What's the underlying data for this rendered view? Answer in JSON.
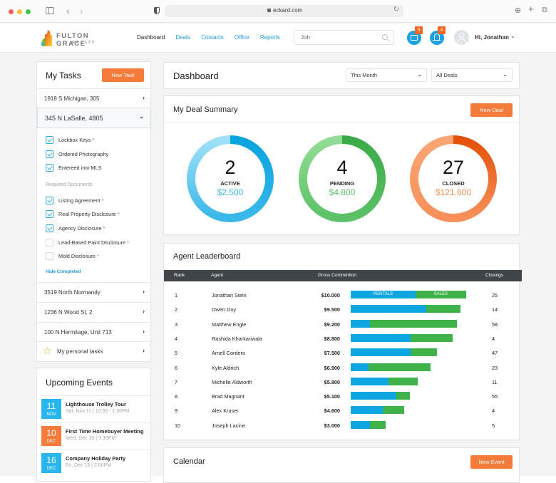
{
  "browser": {
    "url": "eckard.com"
  },
  "header": {
    "logo": {
      "brand": "FULTON GRACE",
      "sub": "REALTY"
    },
    "nav": [
      "Dashboard",
      "Deals",
      "Contacts",
      "Office",
      "Reports"
    ],
    "active_nav": "Dashboard",
    "search": {
      "value": "Joh"
    },
    "messages_badge": "5",
    "notifications_badge": "4",
    "greeting": "Hi, Jonathan"
  },
  "tasks": {
    "title": "My Tasks",
    "new_button": "New Task",
    "collapsed_top": {
      "label": "1918 S Michigan, 305"
    },
    "open_item": {
      "label": "345 N LaSalle, 4805",
      "checklist": [
        {
          "label": "Lockbox Keys",
          "checked": true,
          "required": true
        },
        {
          "label": "Ordered Photography",
          "checked": true,
          "required": false
        },
        {
          "label": "Entereed into MLS",
          "checked": true,
          "required": false
        }
      ],
      "required_docs_label": "Required Documents",
      "documents": [
        {
          "label": "Listing Agreement",
          "checked": true,
          "required": true
        },
        {
          "label": "Real Property Disclosure",
          "checked": true,
          "required": true
        },
        {
          "label": "Agency Disclosure",
          "checked": true,
          "required": true
        },
        {
          "label": "Lead-Based Paint Disclosure",
          "checked": false,
          "required": true
        },
        {
          "label": "Mold Disclosure",
          "checked": false,
          "required": true
        }
      ],
      "hide_completed": "Hide Completed"
    },
    "other_items": [
      "3519 North Normandy",
      "1236 N Wood St, 2",
      "100 N Hermitage, Unit 713"
    ],
    "personal": "My personal tasks"
  },
  "events": {
    "title": "Upcoming Events",
    "items": [
      {
        "day": "11",
        "month": "NOV",
        "title": "Lighthouse Trolley Tour",
        "time": "Sat, Nov 11 | 10:30 - 1:30PM",
        "color": "#29b6ec"
      },
      {
        "day": "10",
        "month": "DEC",
        "title": "First Time Homebuyer Meeting",
        "time": "Wed, Dec 10 | 5:30PM",
        "color": "#f47b3a"
      },
      {
        "day": "16",
        "month": "DEC",
        "title": "Company Holiday Party",
        "time": "Fri, Dec 16 | 2:00PM",
        "color": "#29b6ec"
      }
    ]
  },
  "dashboard": {
    "title": "Dashboard",
    "period_select": "This Month",
    "deals_select": "All Deals"
  },
  "deal_summary": {
    "title": "My Deal Summary",
    "new_button": "New Deal",
    "items": [
      {
        "count": "2",
        "label": "ACTIVE",
        "amount": "$2.500",
        "dark": "#0aa3de",
        "light": "#9fe0f8",
        "text": "#3ab8ea"
      },
      {
        "count": "4",
        "label": "PENDING",
        "amount": "$4.800",
        "dark": "#3aab47",
        "light": "#92dc95",
        "text": "#5cc167"
      },
      {
        "count": "27",
        "label": "CLOSED",
        "amount": "$121.600",
        "dark": "#e4510a",
        "light": "#fba574",
        "text": "#f7905a"
      }
    ]
  },
  "leaderboard": {
    "title": "Agent Leaderboard",
    "columns": [
      "Rank",
      "Agent",
      "Gross Commintion",
      "Closings"
    ],
    "bar_legend": {
      "rentals": "RENTALS",
      "sales": "SALES"
    },
    "max_commission": 10000,
    "rows": [
      {
        "rank": "1",
        "agent": "Jonathan Stein",
        "gross": "$10.000",
        "commission": 10000,
        "rental_share": 0.56,
        "closings": "25"
      },
      {
        "rank": "2",
        "agent": "Owen Duy",
        "gross": "$9.500",
        "commission": 9500,
        "rental_share": 0.69,
        "closings": "14"
      },
      {
        "rank": "3",
        "agent": "Matthew Engle",
        "gross": "$9.200",
        "commission": 9200,
        "rental_share": 0.18,
        "closings": "58"
      },
      {
        "rank": "4",
        "agent": "Rashida Kharkariwala",
        "gross": "$8.800",
        "commission": 8800,
        "rental_share": 0.59,
        "closings": "4"
      },
      {
        "rank": "5",
        "agent": "Arnell Cordero",
        "gross": "$7.500",
        "commission": 7500,
        "rental_share": 0.69,
        "closings": "47"
      },
      {
        "rank": "6",
        "agent": "Kyle Aldrich",
        "gross": "$6.900",
        "commission": 6900,
        "rental_share": 0.22,
        "closings": "23"
      },
      {
        "rank": "7",
        "agent": "Michelle Aldworth",
        "gross": "$5.800",
        "commission": 5800,
        "rental_share": 0.56,
        "closings": "11"
      },
      {
        "rank": "8",
        "agent": "Brad Magnant",
        "gross": "$5.100",
        "commission": 5100,
        "rental_share": 0.77,
        "closings": "55"
      },
      {
        "rank": "9",
        "agent": "Alex Kruser",
        "gross": "$4.600",
        "commission": 4600,
        "rental_share": 0.61,
        "closings": "4"
      },
      {
        "rank": "10",
        "agent": "Joseph Lacine",
        "gross": "$3.000",
        "commission": 3000,
        "rental_share": 0.56,
        "closings": "5"
      }
    ]
  },
  "calendar": {
    "title": "Calendar",
    "new_button": "New Event"
  },
  "colors": {
    "accent_orange": "#f47b3a",
    "link_blue": "#1e9bd7",
    "rentals": "#0ea6e0",
    "sales": "#3fb24a"
  }
}
